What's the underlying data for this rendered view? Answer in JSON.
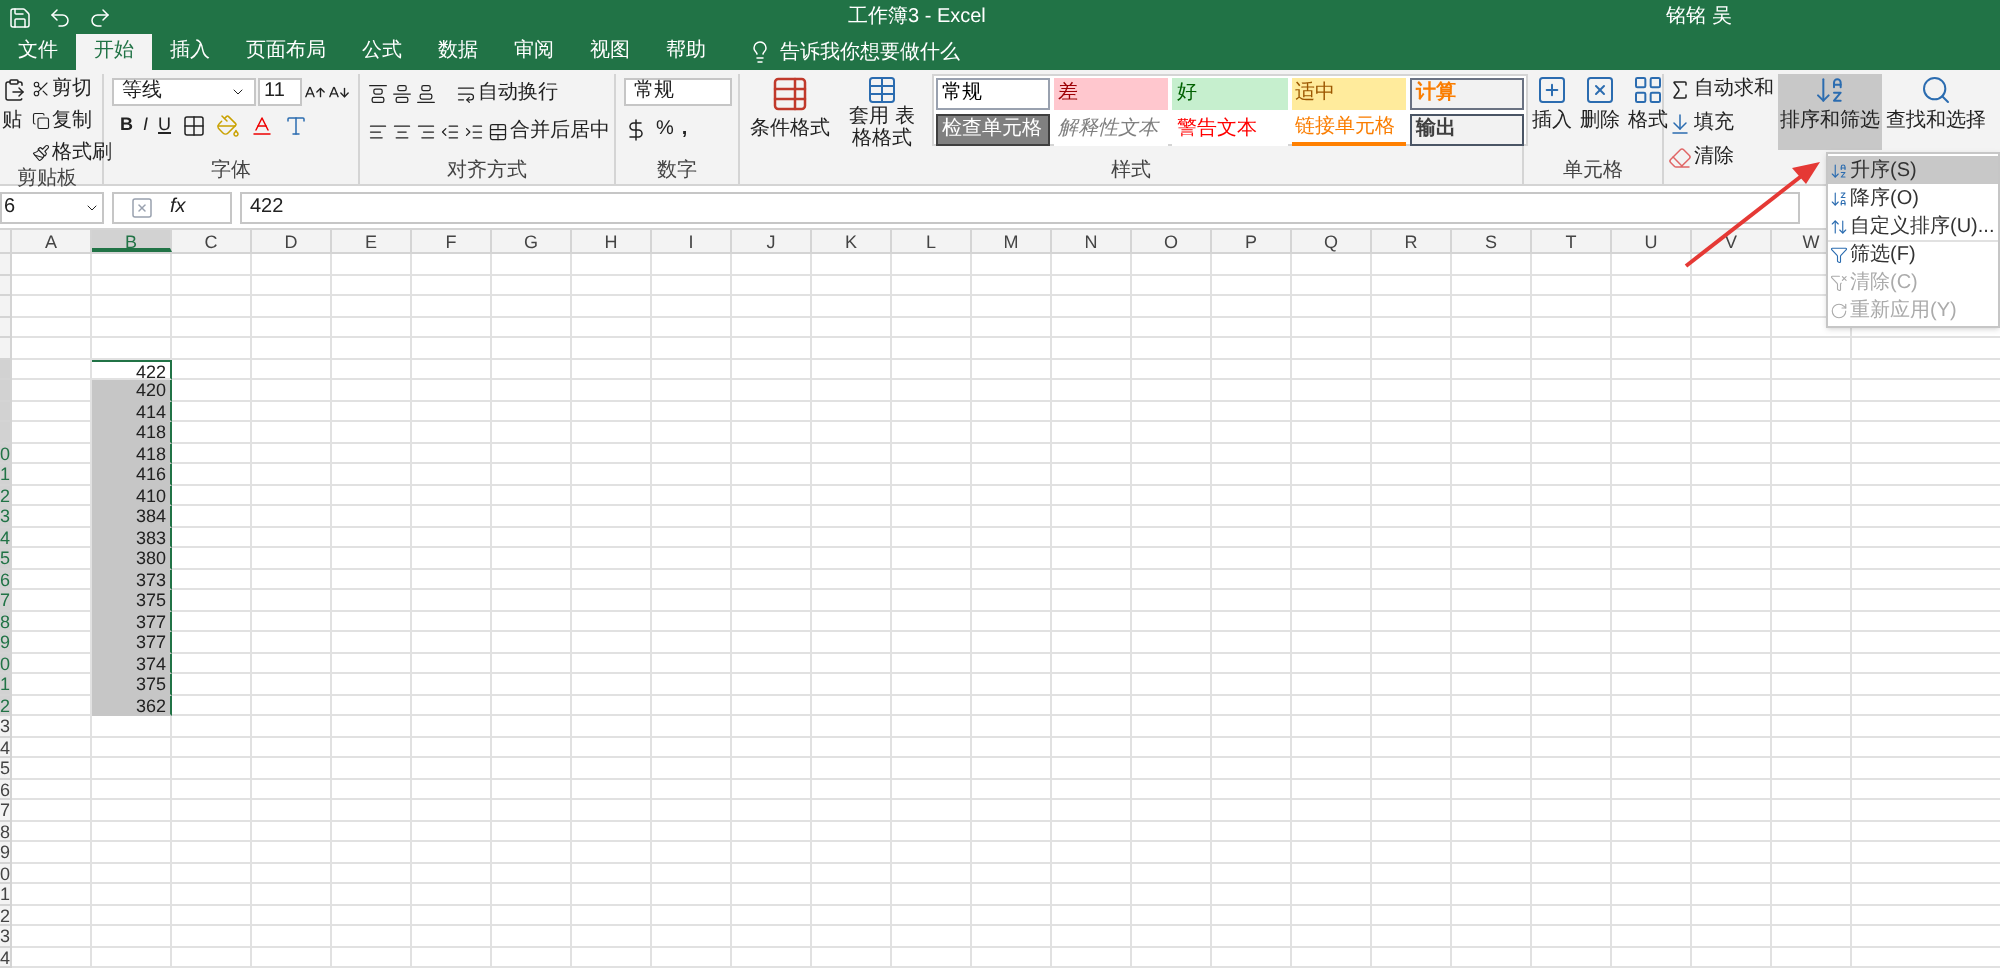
{
  "title_bar": {
    "title": "工作簿3 - Excel",
    "user": "铭铭 吴"
  },
  "tabs": [
    {
      "label": "文件",
      "selected": false
    },
    {
      "label": "开始",
      "selected": true
    },
    {
      "label": "插入",
      "selected": false
    },
    {
      "label": "页面布局",
      "selected": false
    },
    {
      "label": "公式",
      "selected": false
    },
    {
      "label": "数据",
      "selected": false
    },
    {
      "label": "审阅",
      "selected": false
    },
    {
      "label": "视图",
      "selected": false
    },
    {
      "label": "帮助",
      "selected": false
    }
  ],
  "tell_me": "告诉我你想要做什么",
  "clipboard": {
    "label": "剪贴板",
    "paste": "贴",
    "cut": "剪切",
    "copy": "复制",
    "format_painter": "格式刷"
  },
  "font": {
    "label": "字体",
    "name": "等线",
    "size": "11",
    "bold": "B",
    "italic": "I",
    "underline": "U"
  },
  "alignment": {
    "label": "对齐方式",
    "wrap": "自动换行",
    "merge": "合并后居中"
  },
  "number": {
    "label": "数字",
    "format": "常规",
    "percent": "%",
    "comma": ","
  },
  "styles": {
    "label": "样式",
    "conditional": "条件格式",
    "table_format": "套用 表格格式",
    "cells": [
      {
        "text": "常规",
        "kind": "normal"
      },
      {
        "text": "差",
        "kind": "bad"
      },
      {
        "text": "好",
        "kind": "good"
      },
      {
        "text": "适中",
        "kind": "neutral"
      },
      {
        "text": "计算",
        "kind": "calculation"
      },
      {
        "text": "检查单元格",
        "kind": "check"
      },
      {
        "text": "解释性文本",
        "kind": "explanatory"
      },
      {
        "text": "警告文本",
        "kind": "warning"
      },
      {
        "text": "链接单元格",
        "kind": "linked"
      },
      {
        "text": "输出",
        "kind": "output"
      }
    ]
  },
  "cells_group": {
    "label": "单元格",
    "insert": "插入",
    "delete": "删除",
    "format": "格式"
  },
  "editing": {
    "autosum": "自动求和",
    "fill": "填充",
    "clear": "清除",
    "sort_filter": "排序和筛选",
    "sort_filter_expanded": true,
    "find": "查找和选择"
  },
  "sort_menu": [
    {
      "label": "升序(S)",
      "kind": "asc",
      "selected": true,
      "disabled": false
    },
    {
      "label": "降序(O)",
      "kind": "desc",
      "selected": false,
      "disabled": false
    },
    {
      "label": "自定义排序(U)...",
      "kind": "custom",
      "selected": false,
      "disabled": false
    },
    {
      "label": "筛选(F)",
      "kind": "filter",
      "selected": false,
      "disabled": false
    },
    {
      "label": "清除(C)",
      "kind": "clear",
      "selected": false,
      "disabled": true
    },
    {
      "label": "重新应用(Y)",
      "kind": "reapply",
      "selected": false,
      "disabled": true
    }
  ],
  "formula_bar": {
    "name_box": "6",
    "function_label": "fx",
    "value": "422"
  },
  "columns": [
    {
      "label": "A",
      "selected": false
    },
    {
      "label": "B",
      "selected": true
    },
    {
      "label": "C",
      "selected": false
    },
    {
      "label": "D",
      "selected": false
    },
    {
      "label": "E",
      "selected": false
    },
    {
      "label": "F",
      "selected": false
    },
    {
      "label": "G",
      "selected": false
    },
    {
      "label": "H",
      "selected": false
    },
    {
      "label": "I",
      "selected": false
    },
    {
      "label": "J",
      "selected": false
    },
    {
      "label": "K",
      "selected": false
    },
    {
      "label": "L",
      "selected": false
    },
    {
      "label": "M",
      "selected": false
    },
    {
      "label": "N",
      "selected": false
    },
    {
      "label": "O",
      "selected": false
    },
    {
      "label": "P",
      "selected": false
    },
    {
      "label": "Q",
      "selected": false
    },
    {
      "label": "R",
      "selected": false
    },
    {
      "label": "S",
      "selected": false
    },
    {
      "label": "T",
      "selected": false
    },
    {
      "label": "U",
      "selected": false
    },
    {
      "label": "V",
      "selected": false
    },
    {
      "label": "W",
      "selected": false
    }
  ],
  "rows": [
    {
      "selected": false
    },
    {
      "selected": false
    },
    {
      "selected": false
    },
    {
      "selected": false
    },
    {
      "selected": false
    },
    {
      "value": "422",
      "selected": true,
      "active": true
    },
    {
      "value": "420",
      "selected": true,
      "active": false
    },
    {
      "value": "414",
      "selected": true,
      "active": false
    },
    {
      "value": "418",
      "selected": true,
      "active": false
    },
    {
      "header": "0",
      "value": "418",
      "selected": true,
      "active": false
    },
    {
      "header": "1",
      "value": "416",
      "selected": true,
      "active": false
    },
    {
      "header": "2",
      "value": "410",
      "selected": true,
      "active": false
    },
    {
      "header": "3",
      "value": "384",
      "selected": true,
      "active": false
    },
    {
      "header": "4",
      "value": "383",
      "selected": true,
      "active": false
    },
    {
      "header": "5",
      "value": "380",
      "selected": true,
      "active": false
    },
    {
      "header": "6",
      "value": "373",
      "selected": true,
      "active": false
    },
    {
      "header": "7",
      "value": "375",
      "selected": true,
      "active": false
    },
    {
      "header": "8",
      "value": "377",
      "selected": true,
      "active": false
    },
    {
      "header": "9",
      "value": "377",
      "selected": true,
      "active": false
    },
    {
      "header": "0",
      "value": "374",
      "selected": true,
      "active": false
    },
    {
      "header": "1",
      "value": "375",
      "selected": true,
      "active": false
    },
    {
      "header": "2",
      "value": "362",
      "selected": true,
      "active": false
    },
    {
      "header": "3",
      "selected": false
    },
    {
      "header": "4",
      "selected": false
    },
    {
      "header": "5",
      "selected": false
    },
    {
      "header": "6",
      "selected": false
    },
    {
      "header": "7",
      "selected": false
    },
    {
      "header": "8",
      "selected": false
    },
    {
      "header": "9",
      "selected": false
    },
    {
      "header": "0",
      "selected": false
    },
    {
      "header": "1",
      "selected": false
    },
    {
      "header": "2",
      "selected": false
    },
    {
      "header": "3",
      "selected": false
    },
    {
      "header": "4",
      "selected": false
    }
  ]
}
